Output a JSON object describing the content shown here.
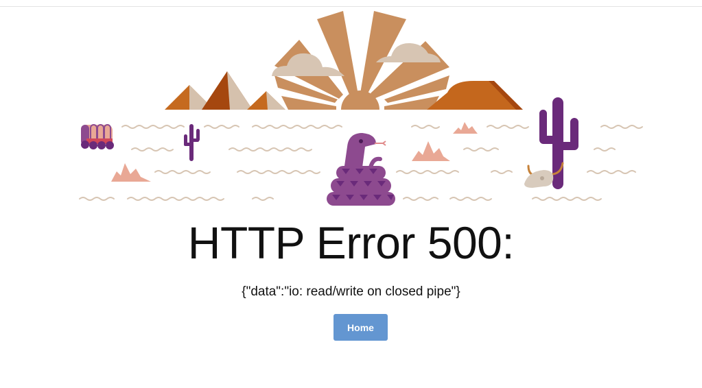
{
  "page": {
    "title": "HTTP Error 500:",
    "message": "{\"data\":\"io: read/write on closed pipe\"}"
  },
  "actions": {
    "home_label": "Home"
  },
  "illustration": {
    "colors": {
      "sun": "#c98f5e",
      "cloud": "#d7c5b3",
      "pyramid_dark": "#c56a1f",
      "pyramid_light": "#d5c1ad",
      "mesa": "#c4671d",
      "cactus": "#6a2a7a",
      "snake": "#8d4a8f",
      "shrub": "#e9a895",
      "sand_wave": "#d7c5b3",
      "skull": "#d8cbbd",
      "horn": "#c6823a"
    }
  }
}
